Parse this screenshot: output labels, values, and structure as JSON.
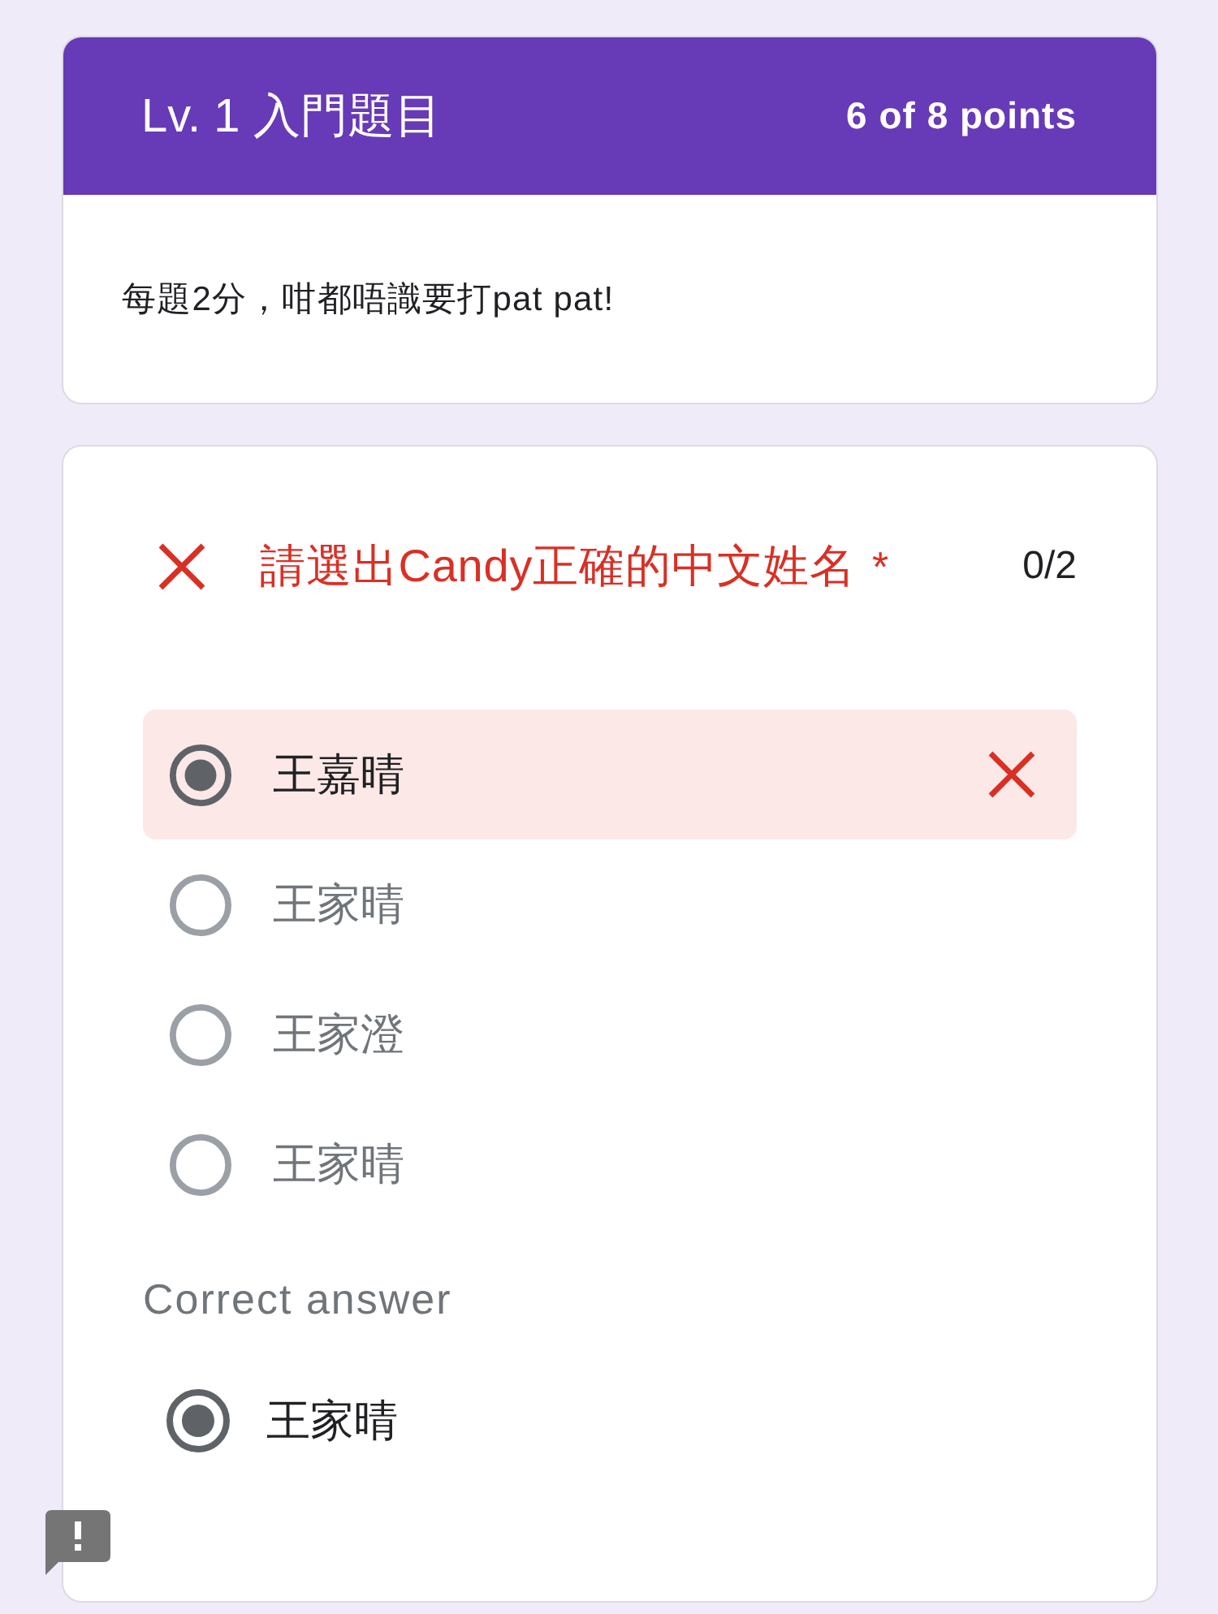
{
  "header": {
    "title": "Lv. 1 入門題目",
    "score": "6 of 8 points",
    "description": "每題2分，咁都唔識要打pat pat!"
  },
  "question": {
    "wrong": true,
    "title": "請選出Candy正確的中文姓名",
    "required_mark": "*",
    "score": "0/2",
    "options": [
      {
        "label": "王嘉晴",
        "selected": true,
        "wrong": true
      },
      {
        "label": "王家晴",
        "selected": false,
        "wrong": false
      },
      {
        "label": "王家澄",
        "selected": false,
        "wrong": false
      },
      {
        "label": "王家晴",
        "selected": false,
        "wrong": false
      }
    ],
    "correct_answer": {
      "heading": "Correct answer",
      "options": [
        {
          "label": "王家晴",
          "selected": true
        }
      ]
    }
  }
}
